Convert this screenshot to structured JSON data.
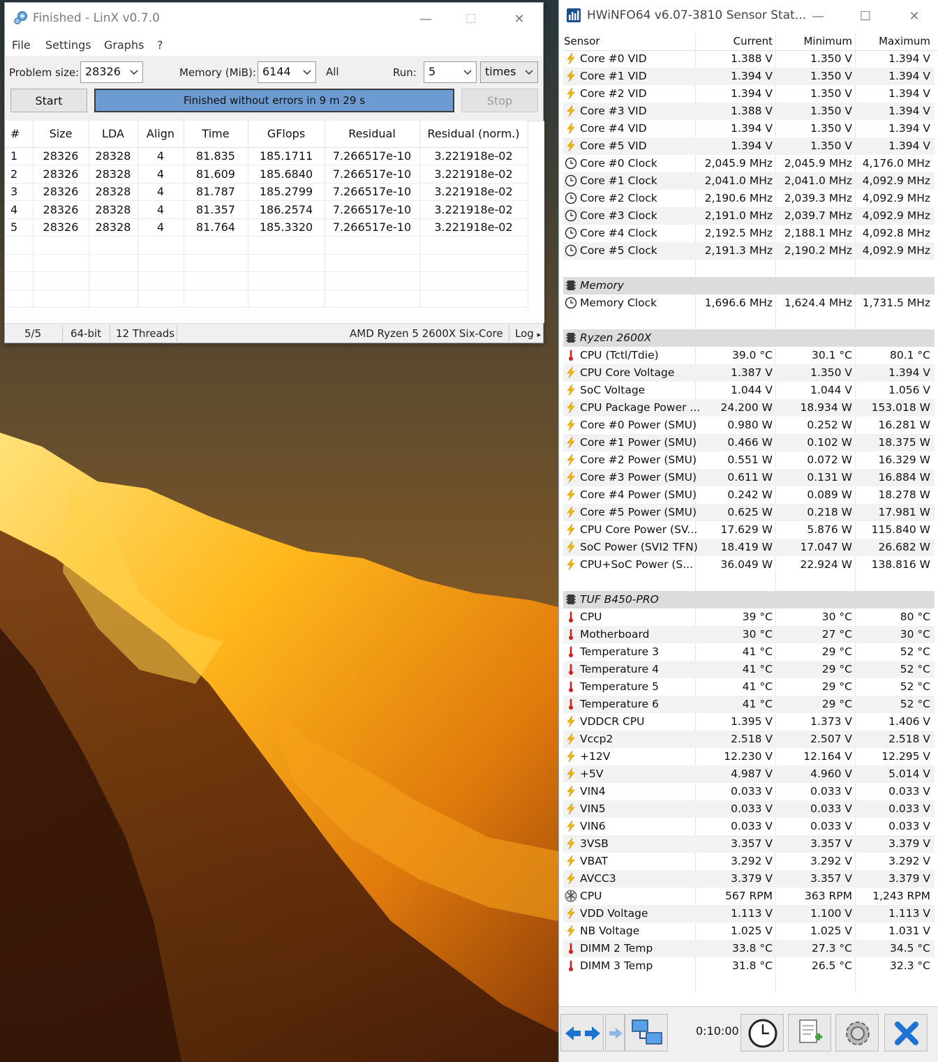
{
  "linx": {
    "title": "Finished - LinX v0.7.0",
    "menu": [
      "File",
      "Settings",
      "Graphs",
      "?"
    ],
    "problem_size_label": "Problem size:",
    "problem_size_value": "28326",
    "memory_label": "Memory (MiB):",
    "memory_value": "6144",
    "all_label": "All",
    "run_label": "Run:",
    "run_value": "5",
    "times_value": "times",
    "start_label": "Start",
    "progress_text": "Finished without errors in 9 m 29 s",
    "progress_fraction": 1.0,
    "stop_label": "Stop",
    "columns": [
      "#",
      "Size",
      "LDA",
      "Align",
      "Time",
      "GFlops",
      "Residual",
      "Residual (norm.)"
    ],
    "rows": [
      [
        "1",
        "28326",
        "28328",
        "4",
        "81.835",
        "185.1711",
        "7.266517e-10",
        "3.221918e-02"
      ],
      [
        "2",
        "28326",
        "28328",
        "4",
        "81.609",
        "185.6840",
        "7.266517e-10",
        "3.221918e-02"
      ],
      [
        "3",
        "28326",
        "28328",
        "4",
        "81.787",
        "185.2799",
        "7.266517e-10",
        "3.221918e-02"
      ],
      [
        "4",
        "28326",
        "28328",
        "4",
        "81.357",
        "186.2574",
        "7.266517e-10",
        "3.221918e-02"
      ],
      [
        "5",
        "28326",
        "28328",
        "4",
        "81.764",
        "185.3320",
        "7.266517e-10",
        "3.221918e-02"
      ]
    ],
    "status": {
      "runs": "5/5",
      "bits": "64-bit",
      "threads": "12 Threads",
      "cpu": "AMD Ryzen 5 2600X Six-Core",
      "log": "Log"
    }
  },
  "hwinfo": {
    "title": "HWiNFO64 v6.07-3810 Sensor Stat...",
    "columns": [
      "Sensor",
      "Current",
      "Minimum",
      "Maximum"
    ],
    "timer": "0:10:00",
    "rows": [
      {
        "type": "sensor",
        "icon": "volt",
        "name": "Core #0 VID",
        "cur": "1.388 V",
        "min": "1.350 V",
        "max": "1.394 V"
      },
      {
        "type": "sensor",
        "icon": "volt",
        "name": "Core #1 VID",
        "cur": "1.394 V",
        "min": "1.350 V",
        "max": "1.394 V"
      },
      {
        "type": "sensor",
        "icon": "volt",
        "name": "Core #2 VID",
        "cur": "1.394 V",
        "min": "1.350 V",
        "max": "1.394 V"
      },
      {
        "type": "sensor",
        "icon": "volt",
        "name": "Core #3 VID",
        "cur": "1.388 V",
        "min": "1.350 V",
        "max": "1.394 V"
      },
      {
        "type": "sensor",
        "icon": "volt",
        "name": "Core #4 VID",
        "cur": "1.394 V",
        "min": "1.350 V",
        "max": "1.394 V"
      },
      {
        "type": "sensor",
        "icon": "volt",
        "name": "Core #5 VID",
        "cur": "1.394 V",
        "min": "1.350 V",
        "max": "1.394 V"
      },
      {
        "type": "sensor",
        "icon": "clock",
        "name": "Core #0 Clock",
        "cur": "2,045.9 MHz",
        "min": "2,045.9 MHz",
        "max": "4,176.0 MHz"
      },
      {
        "type": "sensor",
        "icon": "clock",
        "name": "Core #1 Clock",
        "cur": "2,041.0 MHz",
        "min": "2,041.0 MHz",
        "max": "4,092.9 MHz"
      },
      {
        "type": "sensor",
        "icon": "clock",
        "name": "Core #2 Clock",
        "cur": "2,190.6 MHz",
        "min": "2,039.3 MHz",
        "max": "4,092.9 MHz"
      },
      {
        "type": "sensor",
        "icon": "clock",
        "name": "Core #3 Clock",
        "cur": "2,191.0 MHz",
        "min": "2,039.7 MHz",
        "max": "4,092.9 MHz"
      },
      {
        "type": "sensor",
        "icon": "clock",
        "name": "Core #4 Clock",
        "cur": "2,192.5 MHz",
        "min": "2,188.1 MHz",
        "max": "4,092.8 MHz"
      },
      {
        "type": "sensor",
        "icon": "clock",
        "name": "Core #5 Clock",
        "cur": "2,191.3 MHz",
        "min": "2,190.2 MHz",
        "max": "4,092.9 MHz"
      },
      {
        "type": "blank"
      },
      {
        "type": "group",
        "name": "Memory"
      },
      {
        "type": "sensor",
        "icon": "clock",
        "name": "Memory Clock",
        "cur": "1,696.6 MHz",
        "min": "1,624.4 MHz",
        "max": "1,731.5 MHz"
      },
      {
        "type": "blank"
      },
      {
        "type": "group",
        "name": "Ryzen 2600X"
      },
      {
        "type": "sensor",
        "icon": "temp",
        "name": "CPU (Tctl/Tdie)",
        "cur": "39.0 °C",
        "min": "30.1 °C",
        "max": "80.1 °C"
      },
      {
        "type": "sensor",
        "icon": "volt",
        "name": "CPU Core Voltage",
        "cur": "1.387 V",
        "min": "1.350 V",
        "max": "1.394 V"
      },
      {
        "type": "sensor",
        "icon": "volt",
        "name": "SoC Voltage",
        "cur": "1.044 V",
        "min": "1.044 V",
        "max": "1.056 V"
      },
      {
        "type": "sensor",
        "icon": "volt",
        "name": "CPU Package Power ...",
        "cur": "24.200 W",
        "min": "18.934 W",
        "max": "153.018 W"
      },
      {
        "type": "sensor",
        "icon": "volt",
        "name": "Core #0 Power (SMU)",
        "cur": "0.980 W",
        "min": "0.252 W",
        "max": "16.281 W"
      },
      {
        "type": "sensor",
        "icon": "volt",
        "name": "Core #1 Power (SMU)",
        "cur": "0.466 W",
        "min": "0.102 W",
        "max": "18.375 W"
      },
      {
        "type": "sensor",
        "icon": "volt",
        "name": "Core #2 Power (SMU)",
        "cur": "0.551 W",
        "min": "0.072 W",
        "max": "16.329 W"
      },
      {
        "type": "sensor",
        "icon": "volt",
        "name": "Core #3 Power (SMU)",
        "cur": "0.611 W",
        "min": "0.131 W",
        "max": "16.884 W"
      },
      {
        "type": "sensor",
        "icon": "volt",
        "name": "Core #4 Power (SMU)",
        "cur": "0.242 W",
        "min": "0.089 W",
        "max": "18.278 W"
      },
      {
        "type": "sensor",
        "icon": "volt",
        "name": "Core #5 Power (SMU)",
        "cur": "0.625 W",
        "min": "0.218 W",
        "max": "17.981 W"
      },
      {
        "type": "sensor",
        "icon": "volt",
        "name": "CPU Core Power (SV...",
        "cur": "17.629 W",
        "min": "5.876 W",
        "max": "115.840 W"
      },
      {
        "type": "sensor",
        "icon": "volt",
        "name": "SoC Power (SVI2 TFN)",
        "cur": "18.419 W",
        "min": "17.047 W",
        "max": "26.682 W"
      },
      {
        "type": "sensor",
        "icon": "volt",
        "name": "CPU+SoC Power (S...",
        "cur": "36.049 W",
        "min": "22.924 W",
        "max": "138.816 W"
      },
      {
        "type": "blank"
      },
      {
        "type": "group",
        "name": "TUF B450-PRO"
      },
      {
        "type": "sensor",
        "icon": "temp",
        "name": "CPU",
        "cur": "39 °C",
        "min": "30 °C",
        "max": "80 °C"
      },
      {
        "type": "sensor",
        "icon": "temp",
        "name": "Motherboard",
        "cur": "30 °C",
        "min": "27 °C",
        "max": "30 °C"
      },
      {
        "type": "sensor",
        "icon": "temp",
        "name": "Temperature 3",
        "cur": "41 °C",
        "min": "29 °C",
        "max": "52 °C"
      },
      {
        "type": "sensor",
        "icon": "temp",
        "name": "Temperature 4",
        "cur": "41 °C",
        "min": "29 °C",
        "max": "52 °C"
      },
      {
        "type": "sensor",
        "icon": "temp",
        "name": "Temperature 5",
        "cur": "41 °C",
        "min": "29 °C",
        "max": "52 °C"
      },
      {
        "type": "sensor",
        "icon": "temp",
        "name": "Temperature 6",
        "cur": "41 °C",
        "min": "29 °C",
        "max": "52 °C"
      },
      {
        "type": "sensor",
        "icon": "volt",
        "name": "VDDCR CPU",
        "cur": "1.395 V",
        "min": "1.373 V",
        "max": "1.406 V"
      },
      {
        "type": "sensor",
        "icon": "volt",
        "name": "Vccp2",
        "cur": "2.518 V",
        "min": "2.507 V",
        "max": "2.518 V"
      },
      {
        "type": "sensor",
        "icon": "volt",
        "name": "+12V",
        "cur": "12.230 V",
        "min": "12.164 V",
        "max": "12.295 V"
      },
      {
        "type": "sensor",
        "icon": "volt",
        "name": "+5V",
        "cur": "4.987 V",
        "min": "4.960 V",
        "max": "5.014 V"
      },
      {
        "type": "sensor",
        "icon": "volt",
        "name": "VIN4",
        "cur": "0.033 V",
        "min": "0.033 V",
        "max": "0.033 V"
      },
      {
        "type": "sensor",
        "icon": "volt",
        "name": "VIN5",
        "cur": "0.033 V",
        "min": "0.033 V",
        "max": "0.033 V"
      },
      {
        "type": "sensor",
        "icon": "volt",
        "name": "VIN6",
        "cur": "0.033 V",
        "min": "0.033 V",
        "max": "0.033 V"
      },
      {
        "type": "sensor",
        "icon": "volt",
        "name": "3VSB",
        "cur": "3.357 V",
        "min": "3.357 V",
        "max": "3.379 V"
      },
      {
        "type": "sensor",
        "icon": "volt",
        "name": "VBAT",
        "cur": "3.292 V",
        "min": "3.292 V",
        "max": "3.292 V"
      },
      {
        "type": "sensor",
        "icon": "volt",
        "name": "AVCC3",
        "cur": "3.379 V",
        "min": "3.357 V",
        "max": "3.379 V"
      },
      {
        "type": "sensor",
        "icon": "fan",
        "name": "CPU",
        "cur": "567 RPM",
        "min": "363 RPM",
        "max": "1,243 RPM"
      },
      {
        "type": "sensor",
        "icon": "volt",
        "name": "VDD Voltage",
        "cur": "1.113 V",
        "min": "1.100 V",
        "max": "1.113 V"
      },
      {
        "type": "sensor",
        "icon": "volt",
        "name": "NB Voltage",
        "cur": "1.025 V",
        "min": "1.025 V",
        "max": "1.031 V"
      },
      {
        "type": "sensor",
        "icon": "temp",
        "name": "DIMM 2 Temp",
        "cur": "33.8 °C",
        "min": "27.3 °C",
        "max": "34.5 °C"
      },
      {
        "type": "sensor",
        "icon": "temp",
        "name": "DIMM 3 Temp",
        "cur": "31.8 °C",
        "min": "26.5 °C",
        "max": "32.3 °C"
      }
    ]
  },
  "colors": {
    "progress_fill": "#6b9bd1",
    "volt_icon": "#f5b800",
    "temp_icon": "#d42020",
    "close_x": "#1e73d2"
  }
}
